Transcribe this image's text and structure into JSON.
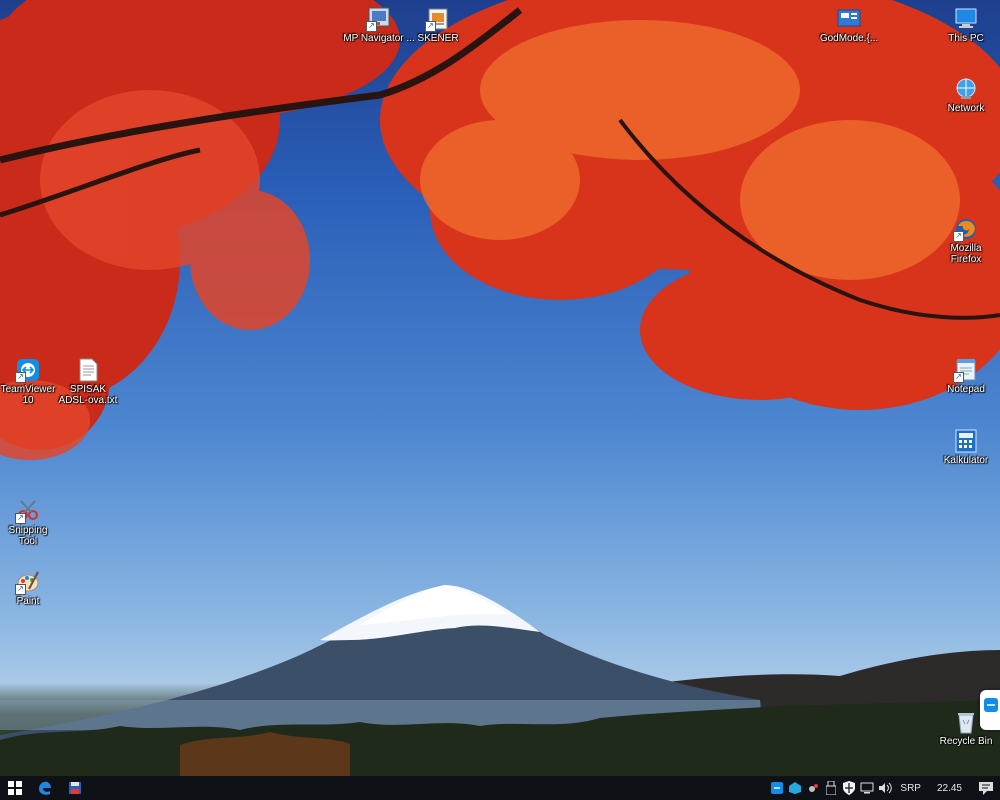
{
  "desktop": {
    "icons": {
      "mp_navigator": "MP Navigator ...",
      "skener": "SKENER",
      "godmode": "GodMode.{...",
      "this_pc": "This PC",
      "network": "Network",
      "firefox": "Mozilla Firefox",
      "teamviewer": "TeamViewer 10",
      "spisak": "SPISAK ADSL-ova.txt",
      "notepad": "Notepad",
      "kalkulator": "Kalkulator",
      "snipping": "Snipping Tool",
      "paint": "Paint",
      "recycle": "Recycle Bin"
    }
  },
  "taskbar": {
    "language": "SRP",
    "clock": "22.45"
  },
  "colors": {
    "taskbar": "#0e1216",
    "sky_top": "#1e3f8e",
    "leaves": "#d8341c",
    "accent": "#1e88e5"
  }
}
